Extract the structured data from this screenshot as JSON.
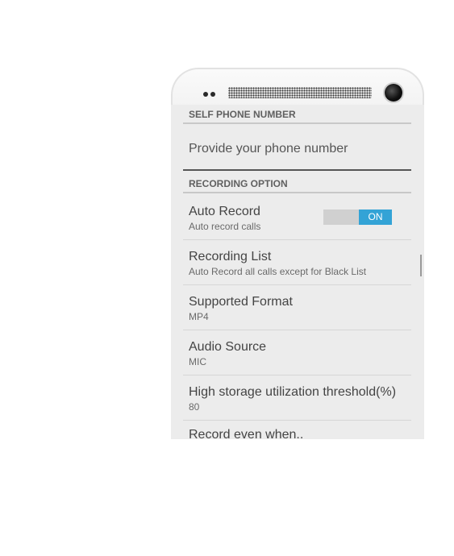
{
  "settings": {
    "section_self": "SELF PHONE NUMBER",
    "phone_placeholder": "Provide your phone number",
    "section_recording": "RECORDING OPTION",
    "auto_record": {
      "title": "Auto Record",
      "subtitle": "Auto record calls",
      "toggle_label": "ON",
      "enabled": true
    },
    "recording_list": {
      "title": "Recording List",
      "subtitle": "Auto Record all calls except for Black List"
    },
    "supported_format": {
      "title": "Supported Format",
      "subtitle": "MP4"
    },
    "audio_source": {
      "title": "Audio Source",
      "subtitle": "MIC"
    },
    "storage_threshold": {
      "title": "High storage utilization threshold(%)",
      "subtitle": "80"
    },
    "record_even_when": {
      "title": "Record even when.."
    }
  },
  "colors": {
    "accent": "#33a3d6",
    "background": "#ececec"
  }
}
